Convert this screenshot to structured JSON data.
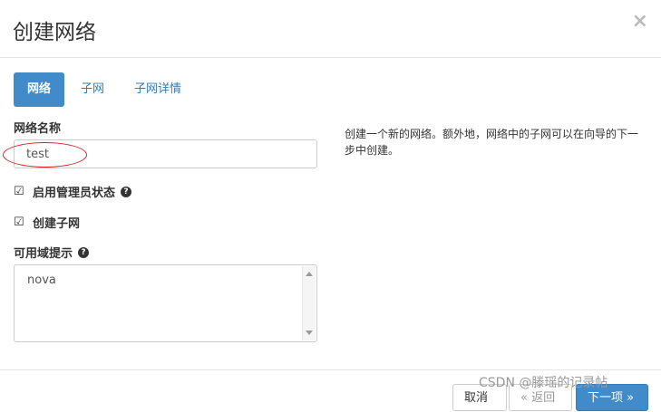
{
  "modal": {
    "title": "创建网络",
    "close_symbol": "×"
  },
  "tabs": [
    {
      "label": "网络",
      "active": true
    },
    {
      "label": "子网",
      "active": false
    },
    {
      "label": "子网详情",
      "active": false
    }
  ],
  "form": {
    "network_name_label": "网络名称",
    "network_name_value": "test",
    "admin_state_label": "启用管理员状态",
    "admin_state_checked": true,
    "create_subnet_label": "创建子网",
    "create_subnet_checked": true,
    "az_hint_label": "可用域提示",
    "az_hint_value": "nova",
    "help_symbol": "?"
  },
  "help_text": "创建一个新的网络。额外地，网络中的子网可以在向导的下一步中创建。",
  "footer": {
    "cancel_label": "取消",
    "back_label": "« 返回",
    "next_label": "下一项 »"
  },
  "watermark": "CSDN @滕瑶的记录帖",
  "colors": {
    "primary": "#428bca",
    "link": "#337ab7",
    "annotation": "#e02020"
  }
}
